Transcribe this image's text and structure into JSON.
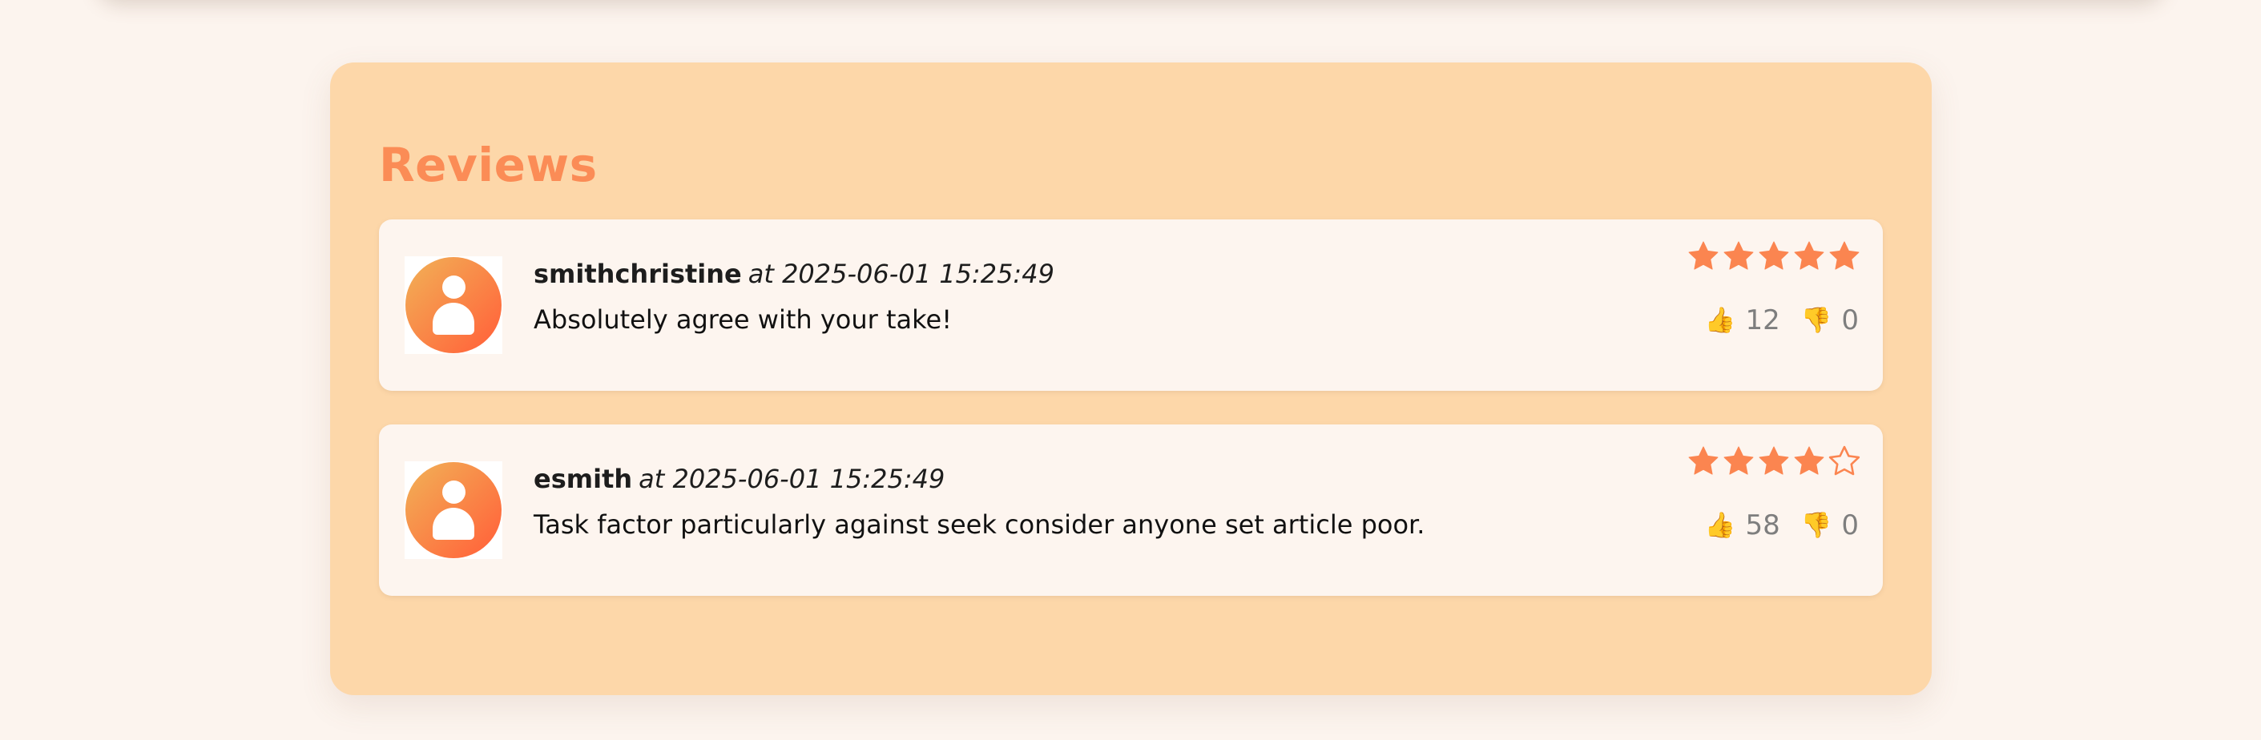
{
  "section": {
    "title": "Reviews"
  },
  "reviews": [
    {
      "author": "smithchristine",
      "at_label": "at 2025-06-01 15:25:49",
      "text": "Absolutely agree with your take!",
      "rating": 5,
      "max_rating": 5,
      "likes": "12",
      "dislikes": "0"
    },
    {
      "author": "esmith",
      "at_label": "at 2025-06-01 15:25:49",
      "text": "Task factor particularly against seek consider anyone set article poor.",
      "rating": 4,
      "max_rating": 5,
      "likes": "58",
      "dislikes": "0"
    }
  ],
  "icons": {
    "avatar": "user-avatar-icon",
    "star_filled": "star-filled-icon",
    "star_empty": "star-empty-icon",
    "like": "thumbs-up-icon",
    "dislike": "thumbs-down-icon"
  },
  "colors": {
    "page_bg": "#fcf4ee",
    "panel_bg": "#fdd7a9",
    "accent": "#fb8c56",
    "card_bg": "#fdf5ef",
    "star": "#fb8550"
  }
}
